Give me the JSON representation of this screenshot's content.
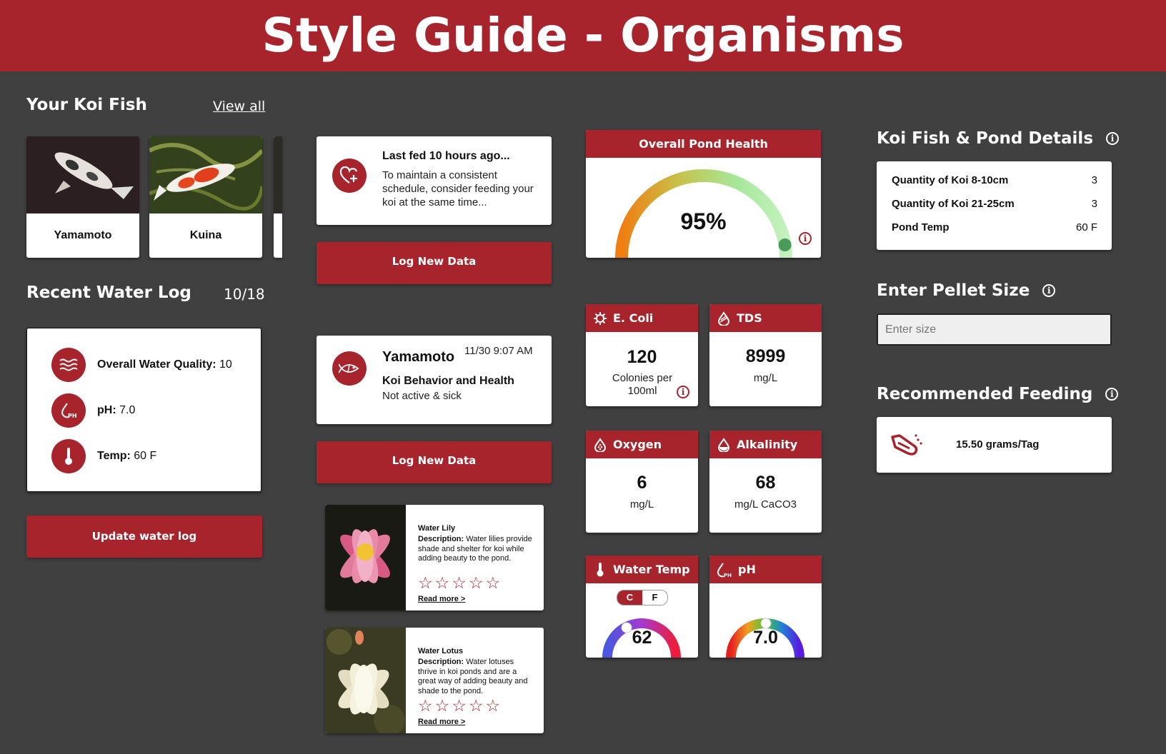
{
  "header": {
    "title": "Style Guide - Organisms"
  },
  "koi": {
    "title": "Your Koi Fish",
    "view_all": "View all",
    "fish": [
      {
        "name": "Yamamoto"
      },
      {
        "name": "Kuina"
      }
    ]
  },
  "water_log": {
    "title": "Recent Water Log",
    "date": "10/18",
    "items": [
      {
        "label": "Overall Water Quality:",
        "value": "10",
        "icon": "waves-icon"
      },
      {
        "label": "pH:",
        "value": "7.0",
        "icon": "ph-drop-icon"
      },
      {
        "label": "Temp:",
        "value": "60 F",
        "icon": "thermometer-icon"
      }
    ],
    "update_button": "Update water log"
  },
  "feeding_card": {
    "title": "Last fed 10 hours ago...",
    "body": "To maintain a consistent schedule, consider feeding your koi at the same time...",
    "button": "Log New Data"
  },
  "behavior_card": {
    "fish_name": "Yamamoto",
    "timestamp": "11/30 9:07 AM",
    "title": "Koi Behavior and Health",
    "status": "Not active & sick",
    "button": "Log New Data"
  },
  "plants": [
    {
      "name": "Water Lily",
      "desc_label": "Description:",
      "desc": "Water lilies provide shade and shelter for koi while adding beauty to the pond.",
      "read_more": "Read more >"
    },
    {
      "name": "Water Lotus",
      "desc_label": "Description:",
      "desc": "Water lotuses thrive in koi ponds and are a great way of adding beauty and shade to the pond.",
      "read_more": "Read more >"
    }
  ],
  "pond_health": {
    "title": "Overall Pond Health",
    "value": "95%",
    "fraction": 0.95
  },
  "metrics": {
    "ecoli": {
      "title": "E. Coli",
      "value": "120",
      "unit": "Colonies per 100ml"
    },
    "tds": {
      "title": "TDS",
      "value": "8999",
      "unit": "mg/L"
    },
    "oxygen": {
      "title": "Oxygen",
      "value": "6",
      "unit": "mg/L"
    },
    "alkalinity": {
      "title": "Alkalinity",
      "value": "68",
      "unit": "mg/L CaCO3"
    },
    "water_temp": {
      "title": "Water Temp",
      "value": "62",
      "unit_c": "C",
      "unit_f": "F"
    },
    "ph": {
      "title": "pH",
      "value": "7.0"
    }
  },
  "details": {
    "title": "Koi Fish & Pond Details",
    "rows": [
      {
        "label": "Quantity of Koi 8-10cm",
        "value": "3"
      },
      {
        "label": "Quantity of Koi 21-25cm",
        "value": "3"
      },
      {
        "label": "Pond Temp",
        "value": "60 F"
      }
    ]
  },
  "pellet": {
    "title": "Enter Pellet Size",
    "placeholder": "Enter size"
  },
  "recommended": {
    "title": "Recommended Feeding",
    "value": "15.50 grams/Tag"
  },
  "colors": {
    "brand": "#a8242c",
    "background": "#404040",
    "card": "#ffffff"
  }
}
